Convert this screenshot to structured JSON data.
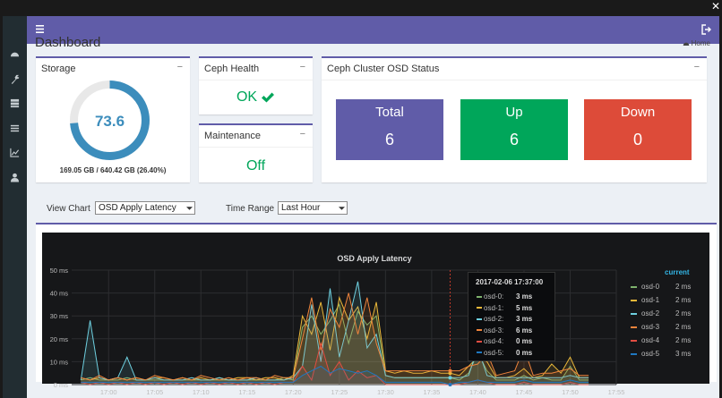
{
  "window": {
    "close_glyph": "✕"
  },
  "header": {
    "menu_icon": "bars-icon",
    "logout_icon": "sign-out-icon",
    "color": "#605ca8"
  },
  "sidebar": {
    "items": [
      {
        "icon": "dashboard-icon"
      },
      {
        "icon": "wrench-icon"
      },
      {
        "icon": "server-icon"
      },
      {
        "icon": "list-icon"
      },
      {
        "icon": "line-chart-icon"
      },
      {
        "icon": "user-icon"
      }
    ]
  },
  "page": {
    "title": "Dashboard",
    "breadcrumb": "Home"
  },
  "storage": {
    "title": "Storage",
    "minimize": "−",
    "percent_label": "73.6",
    "used_fraction": 0.736,
    "usage_text": "169.05 GB / 640.42 GB (26.40%)"
  },
  "health": {
    "title": "Ceph Health",
    "minimize": "−",
    "status": "OK"
  },
  "maintenance": {
    "title": "Maintenance",
    "minimize": "−",
    "status": "Off"
  },
  "osd_status": {
    "title": "Ceph Cluster OSD Status",
    "minimize": "−",
    "tiles": [
      {
        "label": "Total",
        "value": "6",
        "color": "#605ca8"
      },
      {
        "label": "Up",
        "value": "6",
        "color": "#00a65a"
      },
      {
        "label": "Down",
        "value": "0",
        "color": "#dd4b39"
      }
    ]
  },
  "filters": {
    "view_chart_label": "View Chart",
    "view_chart_value": "OSD Apply Latency",
    "time_range_label": "Time Range",
    "time_range_value": "Last Hour"
  },
  "tooltip": {
    "time": "2017-02-06 17:37:00",
    "rows": [
      {
        "label": "osd-0:",
        "value": "3 ms",
        "color": "#7eb26d"
      },
      {
        "label": "osd-1:",
        "value": "5 ms",
        "color": "#eab839"
      },
      {
        "label": "osd-2:",
        "value": "3 ms",
        "color": "#6ed0e0"
      },
      {
        "label": "osd-3:",
        "value": "6 ms",
        "color": "#ef843c"
      },
      {
        "label": "osd-4:",
        "value": "0 ms",
        "color": "#e24d42"
      },
      {
        "label": "osd-5:",
        "value": "0 ms",
        "color": "#1f78c1"
      }
    ]
  },
  "legend": {
    "header": "current",
    "rows": [
      {
        "label": "osd-0",
        "value": "2 ms",
        "color": "#7eb26d"
      },
      {
        "label": "osd-1",
        "value": "2 ms",
        "color": "#eab839"
      },
      {
        "label": "osd-2",
        "value": "2 ms",
        "color": "#6ed0e0"
      },
      {
        "label": "osd-3",
        "value": "2 ms",
        "color": "#ef843c"
      },
      {
        "label": "osd-4",
        "value": "2 ms",
        "color": "#e24d42"
      },
      {
        "label": "osd-5",
        "value": "3 ms",
        "color": "#1f78c1"
      }
    ]
  },
  "chart_data": {
    "type": "line",
    "title": "OSD Apply Latency",
    "xlabel": "",
    "ylabel": "",
    "x_ticks": [
      "17:00",
      "17:05",
      "17:10",
      "17:15",
      "17:20",
      "17:25",
      "17:30",
      "17:35",
      "17:40",
      "17:45",
      "17:50",
      "17:55"
    ],
    "y_ticks": [
      "0 ms",
      "10 ms",
      "20 ms",
      "30 ms",
      "40 ms",
      "50 ms"
    ],
    "ylim": [
      0,
      50
    ],
    "xlim": [
      "16:56",
      "17:55"
    ],
    "grid": true,
    "hover_time": "17:37",
    "x": [
      "16:57",
      "16:58",
      "16:59",
      "17:00",
      "17:01",
      "17:02",
      "17:03",
      "17:04",
      "17:05",
      "17:06",
      "17:07",
      "17:08",
      "17:09",
      "17:10",
      "17:11",
      "17:12",
      "17:13",
      "17:14",
      "17:15",
      "17:16",
      "17:17",
      "17:18",
      "17:19",
      "17:20",
      "17:21",
      "17:22",
      "17:23",
      "17:24",
      "17:25",
      "17:26",
      "17:27",
      "17:28",
      "17:29",
      "17:30",
      "17:31",
      "17:32",
      "17:33",
      "17:34",
      "17:35",
      "17:36",
      "17:37",
      "17:38",
      "17:39",
      "17:40",
      "17:41",
      "17:42",
      "17:43",
      "17:44",
      "17:45",
      "17:46",
      "17:47",
      "17:48",
      "17:49",
      "17:50",
      "17:51",
      "17:52"
    ],
    "series": [
      {
        "name": "osd-0",
        "color": "#7eb26d",
        "values": [
          2,
          3,
          2,
          2,
          2,
          3,
          2,
          2,
          2,
          2,
          2,
          2,
          2,
          2,
          2,
          2,
          2,
          2,
          2,
          2,
          2,
          2,
          3,
          2,
          25,
          30,
          22,
          28,
          35,
          18,
          32,
          26,
          30,
          4,
          3,
          3,
          3,
          3,
          3,
          3,
          3,
          2,
          5,
          14,
          6,
          2,
          2,
          2,
          4,
          2,
          3,
          2,
          2,
          8,
          2,
          2
        ]
      },
      {
        "name": "osd-1",
        "color": "#eab839",
        "values": [
          3,
          2,
          3,
          2,
          3,
          2,
          3,
          2,
          3,
          3,
          2,
          3,
          2,
          3,
          2,
          3,
          2,
          3,
          3,
          2,
          3,
          3,
          2,
          4,
          30,
          22,
          36,
          15,
          38,
          28,
          34,
          20,
          36,
          6,
          5,
          6,
          5,
          5,
          6,
          5,
          5,
          4,
          8,
          12,
          10,
          3,
          3,
          4,
          7,
          3,
          4,
          9,
          5,
          12,
          3,
          3
        ]
      },
      {
        "name": "osd-2",
        "color": "#6ed0e0",
        "values": [
          2,
          28,
          3,
          2,
          3,
          12,
          2,
          2,
          3,
          2,
          2,
          2,
          3,
          2,
          2,
          3,
          2,
          2,
          2,
          3,
          2,
          2,
          2,
          3,
          8,
          35,
          10,
          42,
          12,
          28,
          45,
          16,
          22,
          4,
          3,
          3,
          3,
          3,
          3,
          3,
          3,
          3,
          4,
          16,
          4,
          3,
          3,
          3,
          3,
          3,
          3,
          3,
          3,
          4,
          3,
          3
        ]
      },
      {
        "name": "osd-3",
        "color": "#ef843c",
        "values": [
          3,
          2,
          4,
          2,
          3,
          2,
          3,
          2,
          4,
          3,
          2,
          3,
          2,
          4,
          3,
          2,
          3,
          2,
          3,
          3,
          2,
          4,
          3,
          3,
          20,
          38,
          15,
          33,
          25,
          40,
          22,
          38,
          18,
          6,
          6,
          6,
          6,
          6,
          6,
          6,
          6,
          6,
          8,
          9,
          14,
          4,
          5,
          6,
          16,
          4,
          5,
          5,
          6,
          7,
          4,
          4
        ]
      },
      {
        "name": "osd-4",
        "color": "#e24d42",
        "values": [
          1,
          0,
          1,
          0,
          1,
          0,
          1,
          0,
          1,
          0,
          1,
          0,
          1,
          0,
          1,
          0,
          1,
          0,
          1,
          0,
          1,
          0,
          1,
          1,
          8,
          2,
          18,
          4,
          10,
          2,
          6,
          3,
          4,
          0,
          0,
          0,
          0,
          0,
          0,
          0,
          0,
          0,
          1,
          2,
          1,
          0,
          0,
          0,
          1,
          0,
          0,
          0,
          0,
          1,
          0,
          0
        ]
      },
      {
        "name": "osd-5",
        "color": "#1f78c1",
        "values": [
          1,
          1,
          1,
          1,
          1,
          1,
          1,
          1,
          1,
          1,
          1,
          1,
          1,
          1,
          1,
          1,
          1,
          1,
          1,
          1,
          1,
          1,
          1,
          1,
          4,
          6,
          8,
          5,
          7,
          6,
          5,
          6,
          4,
          1,
          1,
          1,
          1,
          1,
          1,
          1,
          0,
          1,
          1,
          2,
          1,
          1,
          1,
          1,
          2,
          1,
          1,
          1,
          1,
          2,
          1,
          1
        ]
      }
    ]
  }
}
